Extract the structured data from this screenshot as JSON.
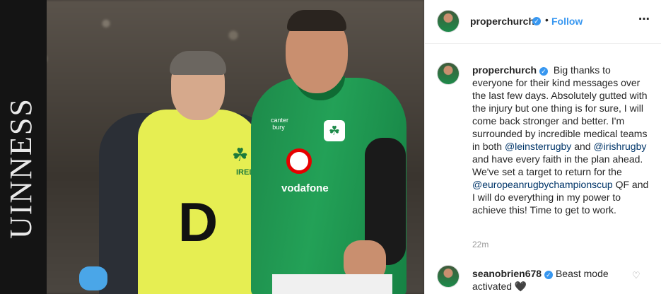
{
  "photo": {
    "post_signage_text": "UINNESS",
    "bib_letter": "D",
    "bib_logo_text": "IREL",
    "shirt_sponsor": "vodafone",
    "kit_brand": "canter bury"
  },
  "header": {
    "username": "properchurch",
    "separator": "•",
    "follow_label": "Follow",
    "more_icon": "⋯",
    "verified_icon": "✓"
  },
  "caption": {
    "username": "properchurch",
    "text_1": "Big thanks to everyone for their kind messages over the last few days. Absolutely gutted with the injury but one thing is for sure, I will come back stronger and better. I'm surrounded by incredible medical teams in both",
    "mention_1": "@leinsterrugby",
    "text_2": "and",
    "mention_2": "@irishrugby",
    "text_3": "and have every faith in the plan ahead. We've set a target to return for the",
    "mention_3": "@europeanrugbychampionscup",
    "text_4": "QF and I will do everything in my power to achieve this! Time to get to work.",
    "time_ago": "22m"
  },
  "comment": {
    "username": "seanobrien678",
    "text": "Beast mode activated 🖤",
    "like_icon": "♡"
  },
  "colors": {
    "link_blue": "#3897f0",
    "mention_blue": "#003569",
    "irish_green": "#1d8a4a"
  }
}
